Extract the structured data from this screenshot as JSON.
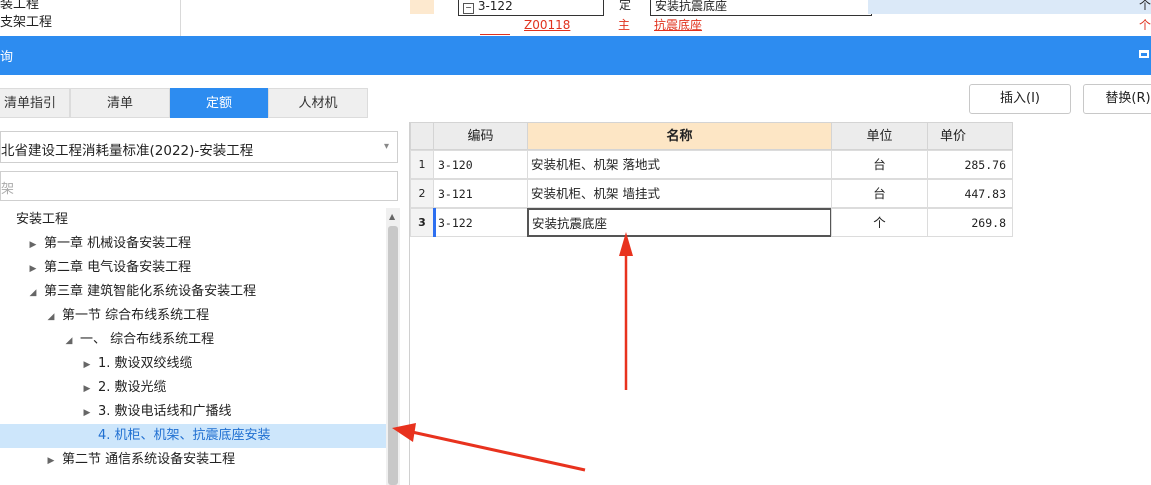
{
  "background": {
    "left_items": [
      "装工程",
      "支架工程"
    ],
    "row1": {
      "code": "3-122",
      "type": "定",
      "name": "安装抗震底座",
      "unit": "个"
    },
    "row2": {
      "code": "Z00118",
      "type": "主",
      "name": "抗震底座",
      "unit": "个"
    }
  },
  "dialog": {
    "title": "询"
  },
  "tabs": [
    {
      "label": "清单指引"
    },
    {
      "label": "清单"
    },
    {
      "label": "定额",
      "active": true
    },
    {
      "label": "人材机"
    }
  ],
  "buttons": {
    "insert": "插入(I)",
    "replace": "替换(R)"
  },
  "standard_select": {
    "value": "北省建设工程消耗量标准(2022)-安装工程"
  },
  "search": {
    "value": "架"
  },
  "tree": [
    {
      "label": "安装工程",
      "level": 0,
      "toggle": ""
    },
    {
      "label": "第一章 机械设备安装工程",
      "level": 1,
      "toggle": "▶"
    },
    {
      "label": "第二章 电气设备安装工程",
      "level": 1,
      "toggle": "▶"
    },
    {
      "label": "第三章 建筑智能化系统设备安装工程",
      "level": 1,
      "toggle": "◢"
    },
    {
      "label": "第一节 综合布线系统工程",
      "level": 2,
      "toggle": "◢"
    },
    {
      "label": "一、 综合布线系统工程",
      "level": 3,
      "toggle": "◢"
    },
    {
      "label": "1. 敷设双绞线缆",
      "level": 4,
      "toggle": "▶"
    },
    {
      "label": "2. 敷设光缆",
      "level": 4,
      "toggle": "▶"
    },
    {
      "label": "3. 敷设电话线和广播线",
      "level": 4,
      "toggle": "▶"
    },
    {
      "label": "4. 机柜、机架、抗震底座安装",
      "level": 4,
      "toggle": "",
      "selected": true
    },
    {
      "label": "第二节 通信系统设备安装工程",
      "level": 2,
      "toggle": "▶"
    }
  ],
  "grid": {
    "headers": {
      "code": "编码",
      "name": "名称",
      "unit": "单位",
      "price": "单价"
    },
    "rows": [
      {
        "num": "1",
        "code": "3-120",
        "name": "安装机柜、机架 落地式",
        "unit": "台",
        "price": "285.76"
      },
      {
        "num": "2",
        "code": "3-121",
        "name": "安装机柜、机架 墙挂式",
        "unit": "台",
        "price": "447.83"
      },
      {
        "num": "3",
        "code": "3-122",
        "name": "安装抗震底座",
        "unit": "个",
        "price": "269.8"
      }
    ]
  },
  "annotation_color": "#e8321e"
}
